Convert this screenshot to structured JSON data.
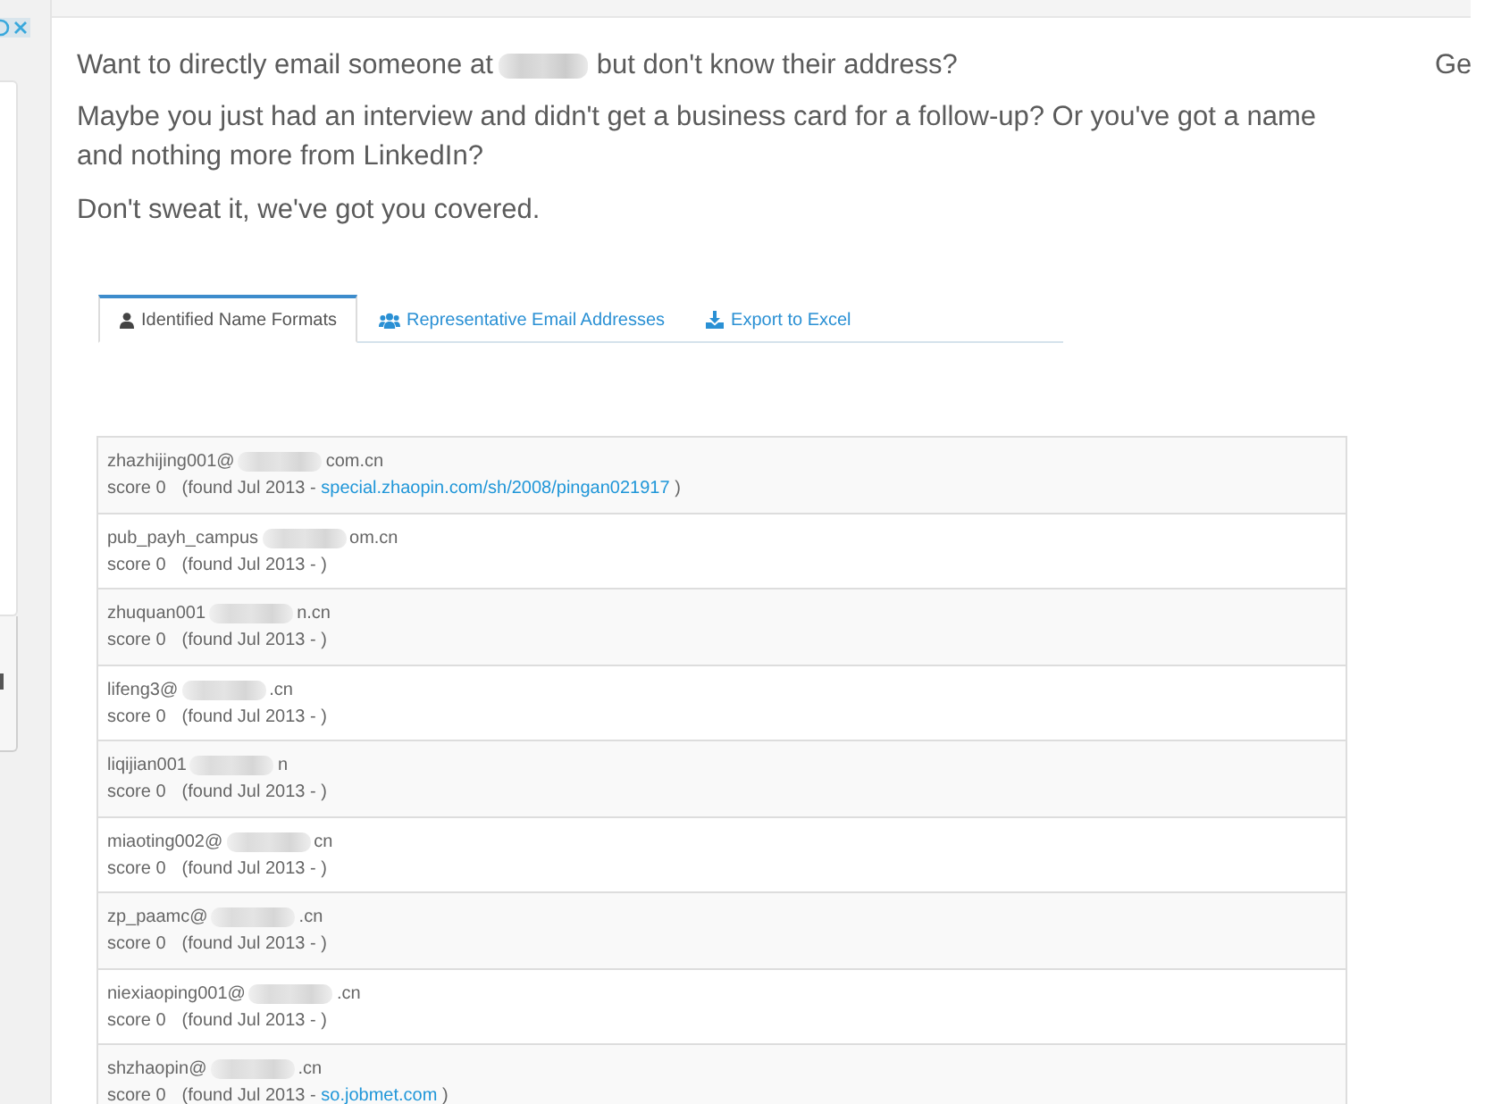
{
  "intro": {
    "question_start": "Want to directly email someone at",
    "question_end": "but don't know their address?",
    "paragraphs": [
      "Maybe you just had an interview and didn't get a business card for a follow-up? Or you've got a name and nothing more from LinkedIn?",
      "Don't sweat it, we've got you covered."
    ]
  },
  "right_column_text": "Ge",
  "tabs": [
    {
      "label": "Identified Name Formats",
      "selected": true
    },
    {
      "label": "Representative Email Addresses",
      "selected": false
    },
    {
      "label": "Export to Excel",
      "selected": false
    }
  ],
  "results": [
    {
      "email_prefix": "zhazhijing001@",
      "email_suffix": "com.cn",
      "score": "score 0",
      "found": "(found Jul 2013 -",
      "source": "special.zhaopin.com/sh/2008/pingan021917",
      "found_end": ")"
    },
    {
      "email_prefix": "pub_payh_campus",
      "email_suffix": "om.cn",
      "score": "score 0",
      "found": "(found Jul 2013 -",
      "found_end": ")"
    },
    {
      "email_prefix": "zhuquan001",
      "email_suffix": "n.cn",
      "score": "score 0",
      "found": "(found Jul 2013 -",
      "found_end": ")"
    },
    {
      "email_prefix": "lifeng3@",
      "email_suffix": ".cn",
      "score": "score 0",
      "found": "(found Jul 2013 -",
      "found_end": ")"
    },
    {
      "email_prefix": "liqijian001",
      "email_suffix": "n",
      "score": "score 0",
      "found": "(found Jul 2013 -",
      "found_end": ")"
    },
    {
      "email_prefix": "miaoting002@",
      "email_suffix": "cn",
      "score": "score 0",
      "found": "(found Jul 2013 -",
      "found_end": ")"
    },
    {
      "email_prefix": "zp_paamc@",
      "email_suffix": ".cn",
      "score": "score 0",
      "found": "(found Jul 2013 -",
      "found_end": ")"
    },
    {
      "email_prefix": "niexiaoping001@",
      "email_suffix": ".cn",
      "score": "score 0",
      "found": "(found Jul 2013 -",
      "found_end": ")"
    },
    {
      "email_prefix": "shzhaopin@",
      "email_suffix": ".cn",
      "score": "score 0",
      "found": "(found Jul 2013 -",
      "source": "so.jobmet.com",
      "found_end": ")"
    }
  ]
}
